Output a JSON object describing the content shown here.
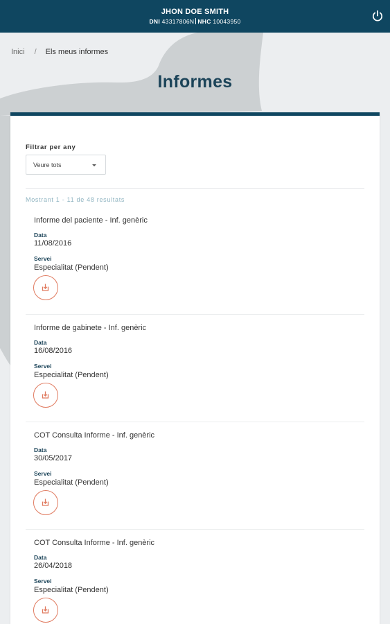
{
  "header": {
    "patient_name": "JHON DOE SMITH",
    "dni_label": "DNI",
    "dni_value": "43317806N",
    "nhc_label": "NHC",
    "nhc_value": "10043950",
    "power_icon": "power-icon"
  },
  "breadcrumb": {
    "home": "Inici",
    "separator": "/",
    "current": "Els meus informes"
  },
  "page": {
    "title": "Informes"
  },
  "filter": {
    "label": "Filtrar per any",
    "selected": "Veure tots"
  },
  "results_text": "Mostrant 1 - 11 de 48 resultats",
  "reports": [
    {
      "title": "Informe del paciente - Inf. genèric",
      "date_label": "Data",
      "date": "11/08/2016",
      "service_label": "Servei",
      "service": "Especialitat (Pendent)"
    },
    {
      "title": "Informe de gabinete - Inf. genèric",
      "date_label": "Data",
      "date": "16/08/2016",
      "service_label": "Servei",
      "service": "Especialitat (Pendent)"
    },
    {
      "title": "COT Consulta Informe - Inf. genèric",
      "date_label": "Data",
      "date": "30/05/2017",
      "service_label": "Servei",
      "service": "Especialitat (Pendent)"
    },
    {
      "title": "COT Consulta Informe - Inf. genèric",
      "date_label": "Data",
      "date": "26/04/2018",
      "service_label": "Servei",
      "service": "Especialitat (Pendent)"
    }
  ],
  "colors": {
    "header_bg": "#0f4660",
    "title": "#1c4459",
    "accent_download": "#e07a5f",
    "results_text": "#8fb4c1"
  }
}
